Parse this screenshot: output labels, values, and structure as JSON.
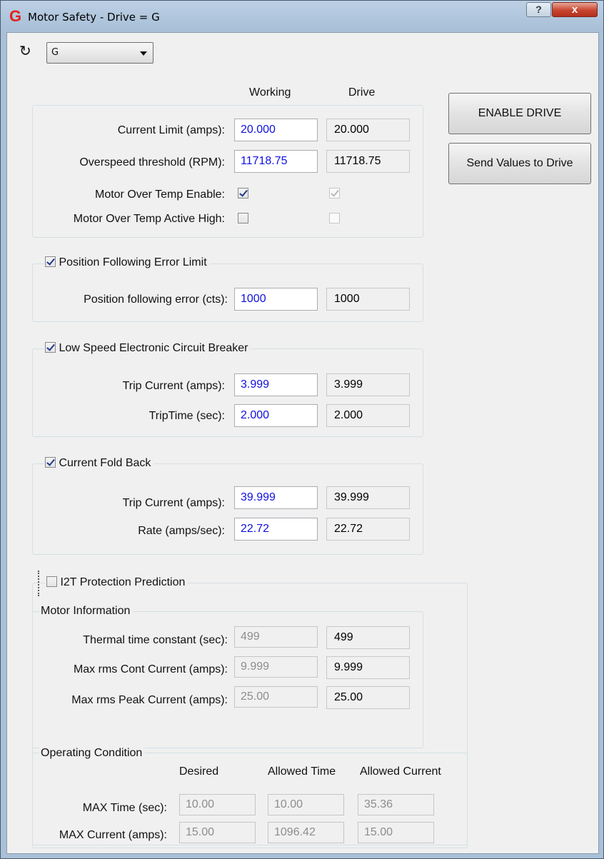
{
  "window": {
    "title": "Motor Safety - Drive = G",
    "help_label": "?",
    "close_label": "x",
    "logo_letter": "G"
  },
  "toolbar": {
    "refresh_icon": "↻",
    "drive_select": "G"
  },
  "columns": {
    "working": "Working",
    "drive": "Drive"
  },
  "buttons": {
    "enable_drive": "ENABLE DRIVE",
    "send_values": "Send Values to Drive"
  },
  "motor": {
    "current_limit": {
      "label": "Current Limit (amps):",
      "working": "20.000",
      "drive": "20.000"
    },
    "overspeed": {
      "label": "Overspeed threshold (RPM):",
      "working": "11718.75",
      "drive": "11718.75"
    },
    "over_temp_enable": {
      "label": "Motor Over Temp Enable:",
      "working": true,
      "drive": true
    },
    "over_temp_active_high": {
      "label": "Motor Over Temp Active High:",
      "working": false,
      "drive": false
    }
  },
  "position_following": {
    "title": "Position Following Error Limit",
    "enabled": true,
    "error": {
      "label": "Position following error (cts):",
      "working": "1000",
      "drive": "1000"
    }
  },
  "circuit_breaker": {
    "title": "Low Speed  Electronic Circuit Breaker",
    "enabled": true,
    "trip_current": {
      "label": "Trip Current (amps):",
      "working": "3.999",
      "drive": "3.999"
    },
    "trip_time": {
      "label": "TripTime (sec):",
      "working": "2.000",
      "drive": "2.000"
    }
  },
  "fold_back": {
    "title": "Current Fold Back",
    "enabled": true,
    "trip_current": {
      "label": "Trip Current (amps):",
      "working": "39.999",
      "drive": "39.999"
    },
    "rate": {
      "label": "Rate (amps/sec):",
      "working": "22.72",
      "drive": "22.72"
    }
  },
  "i2t": {
    "title": "I2T Protection Prediction",
    "enabled": false,
    "motor_info": {
      "title": "Motor Information",
      "thermal": {
        "label": "Thermal time constant (sec):",
        "working": "499",
        "drive": "499"
      },
      "max_cont": {
        "label": "Max rms Cont Current (amps):",
        "working": "9.999",
        "drive": "9.999"
      },
      "max_peak": {
        "label": "Max rms Peak Current  (amps):",
        "working": "25.00",
        "drive": "25.00"
      }
    },
    "operating": {
      "title": "Operating Condition",
      "headers": {
        "desired": "Desired",
        "allowed_time": "Allowed Time",
        "allowed_current": "Allowed Current"
      },
      "max_time": {
        "label": "MAX Time (sec):",
        "desired": "10.00",
        "allowed_time": "10.00",
        "allowed_current": "35.36"
      },
      "max_current": {
        "label": "MAX Current (amps):",
        "desired": "15.00",
        "allowed_time": "1096.42",
        "allowed_current": "15.00"
      }
    }
  }
}
